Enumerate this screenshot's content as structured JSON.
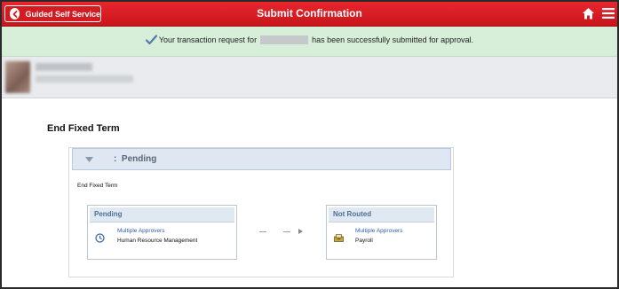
{
  "header": {
    "back_label": "Guided Self Service",
    "title": "Submit Confirmation"
  },
  "banner": {
    "message_prefix": "Your transaction request for",
    "message_suffix": "has been successfully submitted for approval."
  },
  "section": {
    "title": "End Fixed Term"
  },
  "approval": {
    "status_separator": ":",
    "status": "Pending",
    "flow_title": "End Fixed Term",
    "steps": [
      {
        "status": "Pending",
        "approver_link": "Multiple Approvers",
        "role": "Human Resource Management",
        "icon": "clock-icon"
      },
      {
        "status": "Not Routed",
        "approver_link": "Multiple Approvers",
        "role": "Payroll",
        "icon": "inbox-icon"
      }
    ]
  },
  "colors": {
    "header_red": "#d31c22",
    "banner_green": "#d7eed9",
    "panel_blue": "#dfe8f2",
    "link_blue": "#2f5fa8"
  }
}
